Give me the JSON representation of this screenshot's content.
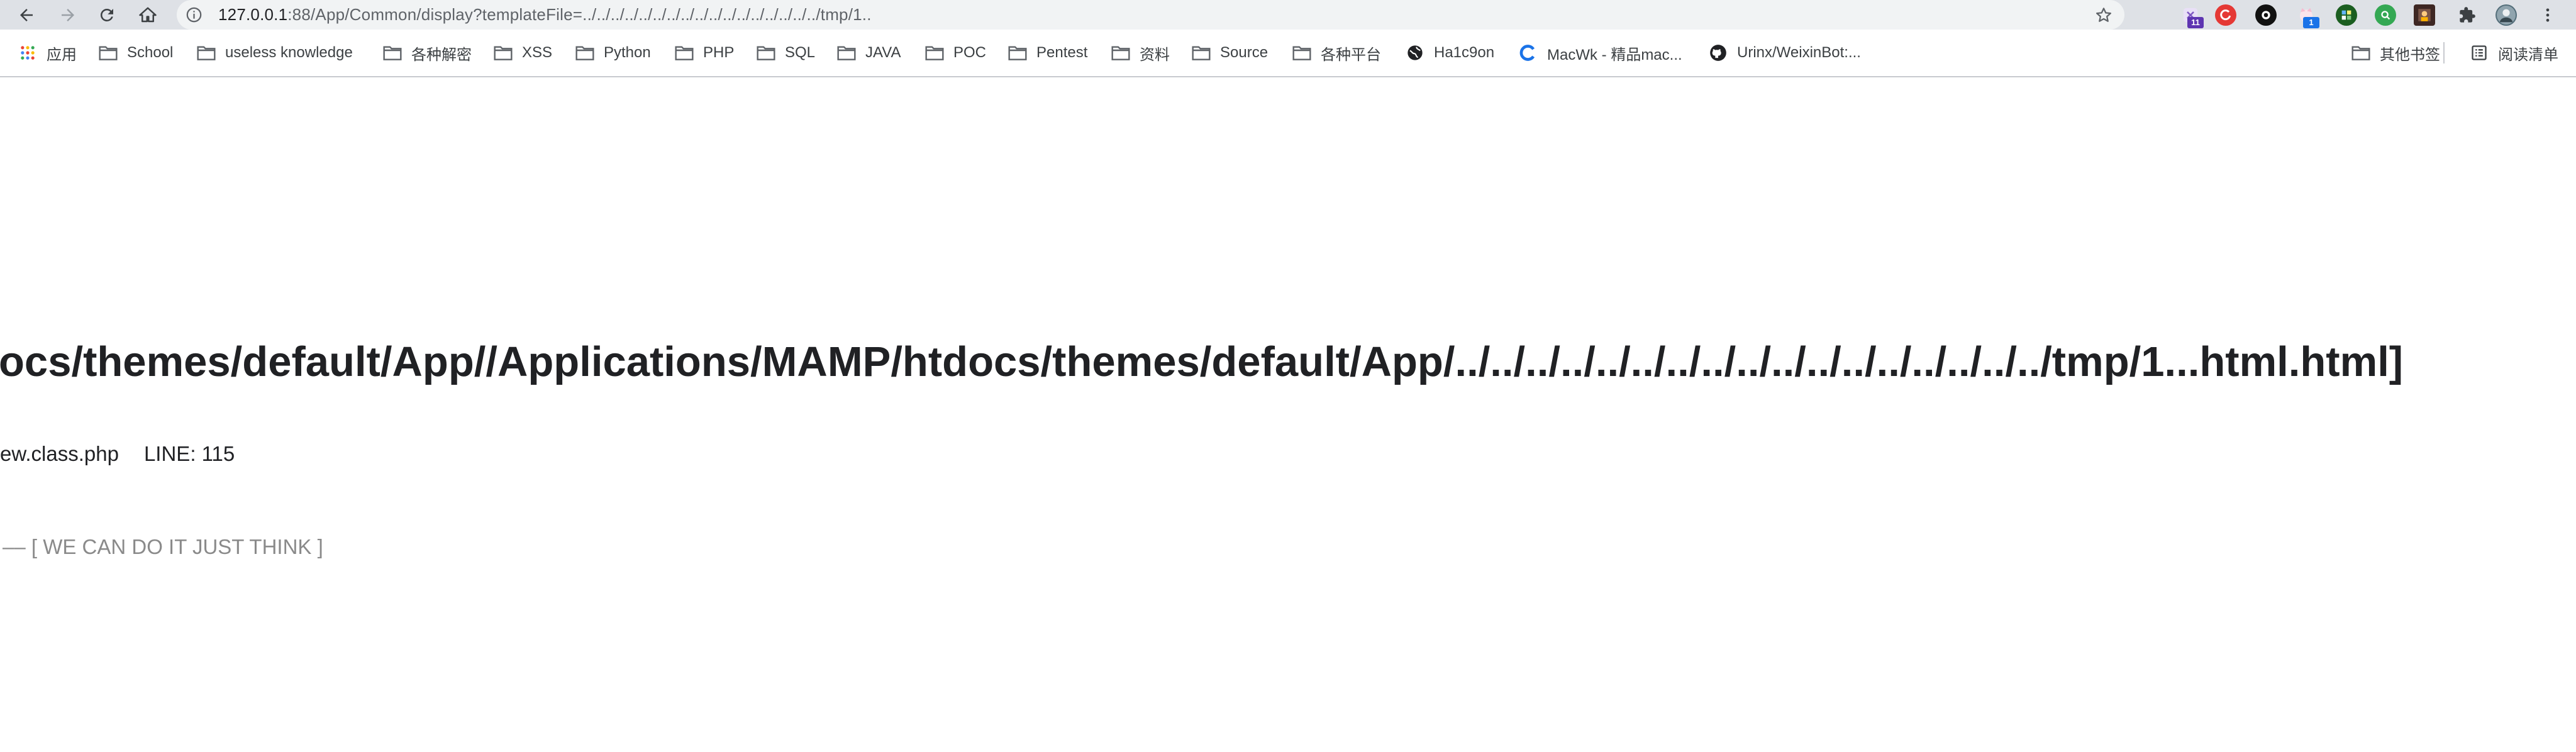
{
  "browser": {
    "url_host": "127.0.0.1",
    "url_rest": ":88/App/Common/display?templateFile=../../../../../../../../../../../../../../../../../tmp/1..",
    "extension_badges": [
      "11",
      "1"
    ]
  },
  "bookmarks": {
    "apps_label": "应用",
    "items": [
      {
        "label": "School"
      },
      {
        "label": "useless knowledge"
      },
      {
        "label": "各种解密"
      },
      {
        "label": "XSS"
      },
      {
        "label": "Python"
      },
      {
        "label": "PHP"
      },
      {
        "label": "SQL"
      },
      {
        "label": "JAVA"
      },
      {
        "label": "POC"
      },
      {
        "label": "Pentest"
      },
      {
        "label": "资料"
      },
      {
        "label": "Source"
      },
      {
        "label": "各种平台"
      },
      {
        "label": "Ha1c9on"
      },
      {
        "label": "MacWk - 精品mac..."
      },
      {
        "label": "Urinx/WeixinBot:..."
      }
    ],
    "other_bookmarks": "其他书签",
    "reading_list": "阅读清单"
  },
  "page": {
    "error_title": "ocs/themes/default/App//Applications/MAMP/htdocs/themes/default/App/../../../../../../../../../../../../../../../../../tmp/1...html.html]",
    "error_file": "ew.class.php",
    "error_line": "LINE: 115",
    "slogan": "–– [ WE CAN DO IT JUST THINK ]"
  }
}
